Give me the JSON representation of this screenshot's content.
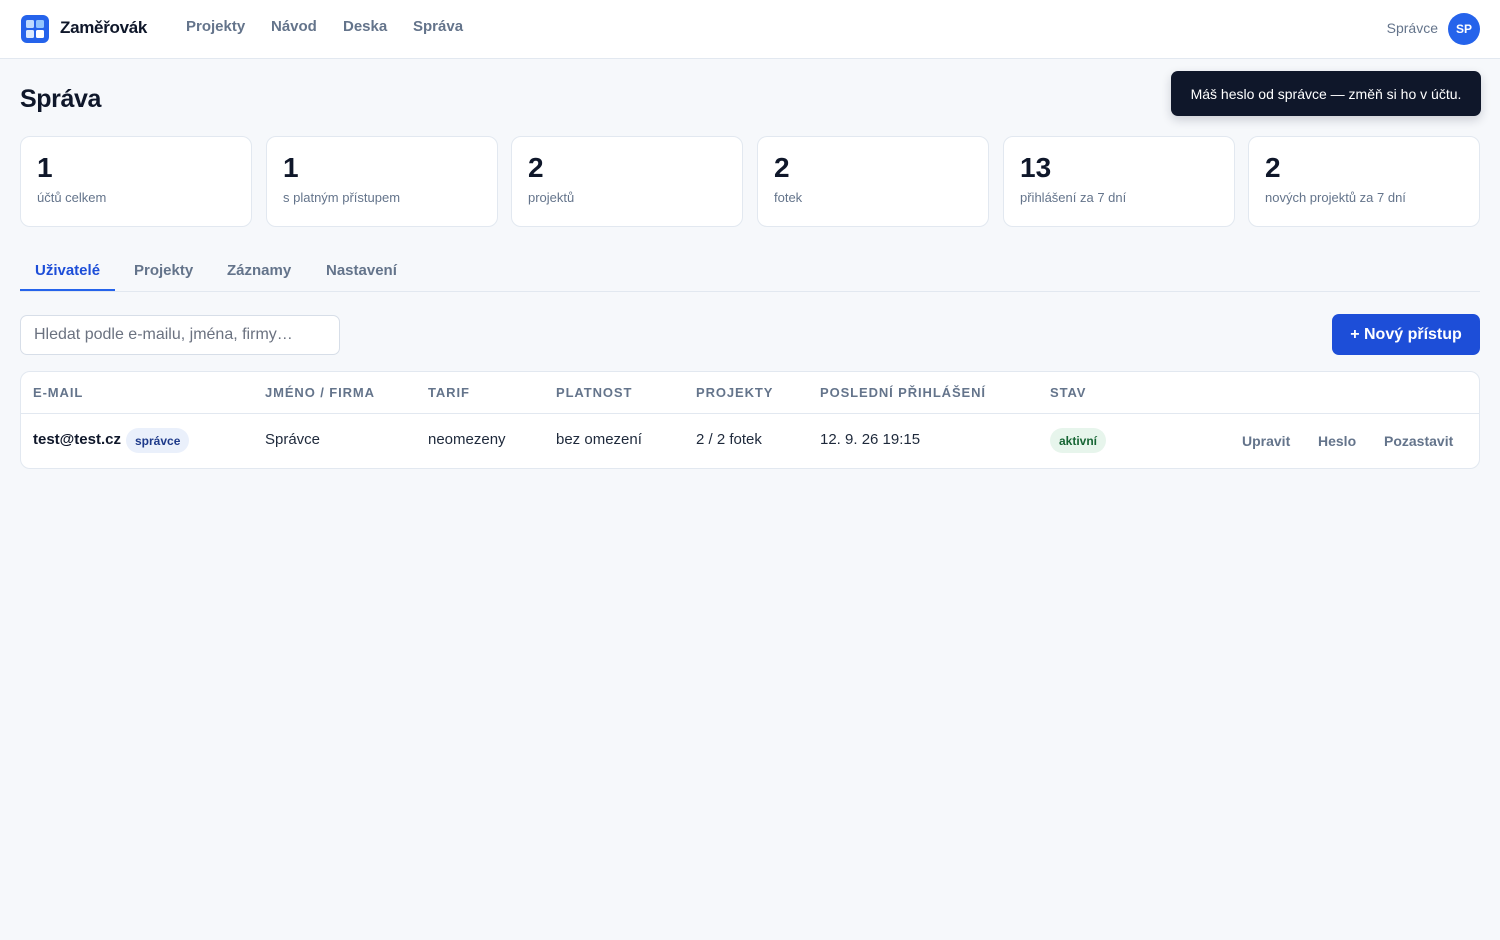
{
  "app": {
    "brand": "Zaměřovák",
    "logo_icon": "grid-logo-icon",
    "accent_color": "#2563eb"
  },
  "nav": {
    "items": [
      {
        "label": "Projekty"
      },
      {
        "label": "Návod"
      },
      {
        "label": "Deska"
      },
      {
        "label": "Správa"
      }
    ]
  },
  "user": {
    "role": "Správce",
    "initials": "SP"
  },
  "page": {
    "title": "Správa"
  },
  "toast": {
    "message": "Máš heslo od správce — změň si ho v účtu."
  },
  "stats": [
    {
      "value": "1",
      "label": "účtů celkem"
    },
    {
      "value": "1",
      "label": "s platným přístupem"
    },
    {
      "value": "2",
      "label": "projektů"
    },
    {
      "value": "2",
      "label": "fotek"
    },
    {
      "value": "13",
      "label": "přihlášení za 7 dní"
    },
    {
      "value": "2",
      "label": "nových projektů za 7 dní"
    }
  ],
  "tabs": [
    {
      "label": "Uživatelé",
      "active": true
    },
    {
      "label": "Projekty",
      "active": false
    },
    {
      "label": "Záznamy",
      "active": false
    },
    {
      "label": "Nastavení",
      "active": false
    }
  ],
  "search": {
    "placeholder": "Hledat podle e-mailu, jména, firmy…",
    "value": ""
  },
  "new_access_button": {
    "label": "+ Nový přístup"
  },
  "table": {
    "columns": [
      "E-MAIL",
      "JMÉNO / FIRMA",
      "TARIF",
      "PLATNOST",
      "PROJEKTY",
      "POSLEDNÍ PŘIHLÁŠENÍ",
      "STAV"
    ],
    "rows": [
      {
        "email": "test@test.cz",
        "role_badge": "správce",
        "name": "Správce",
        "tariff": "neomezeny",
        "validity": "bez omezení",
        "projects": "2 / 2 fotek",
        "last_login": "12. 9. 26 19:15",
        "status": "aktivní",
        "actions": [
          "Upravit",
          "Heslo",
          "Pozastavit"
        ]
      }
    ]
  }
}
